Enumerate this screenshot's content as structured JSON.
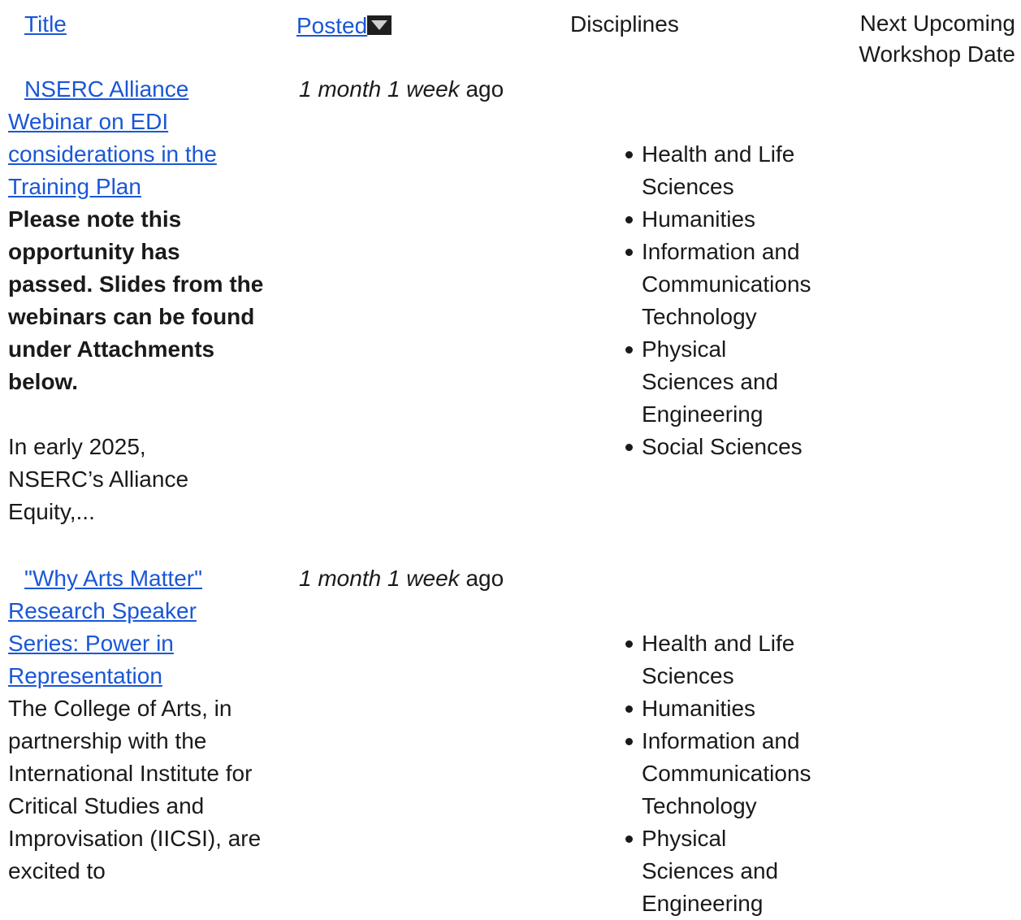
{
  "header": {
    "title": "Title",
    "posted": "Posted",
    "disciplines": "Disciplines",
    "next_upcoming": "Next Upcoming",
    "workshop_date": "Workshop Date"
  },
  "rows": [
    {
      "title": "NSERC Alliance Webinar on EDI considerations in the Training Plan",
      "note": "Please note this opportunity has passed. Slides from the webinars can be found under Attachments below.",
      "desc": "In early 2025, NSERC’s Alliance Equity,...",
      "posted_em": "1 month 1 week",
      "posted_suffix": " ago",
      "disciplines": [
        "Health and Life Sciences",
        "Humanities",
        "Information and Communications Technology",
        "Physical Sciences and Engineering",
        "Social Sciences"
      ]
    },
    {
      "title": "\"Why Arts Matter\" Research Speaker Series: Power in Representation",
      "desc": "The College of Arts, in partnership with the International Institute for Critical Studies and Improvisation (IICSI), are excited to",
      "posted_em": "1 month 1 week",
      "posted_suffix": " ago",
      "disciplines": [
        "Health and Life Sciences",
        "Humanities",
        "Information and Communications Technology",
        "Physical Sciences and Engineering"
      ]
    }
  ]
}
